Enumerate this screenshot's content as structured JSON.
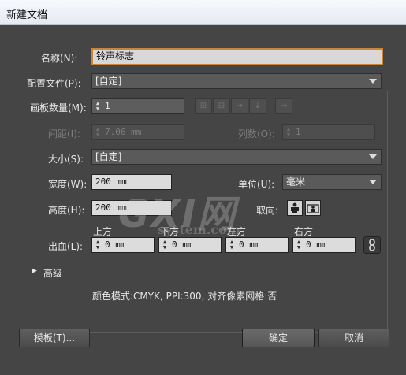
{
  "window": {
    "title": "新建文档"
  },
  "name": {
    "label": "名称(N):",
    "value": "铃声标志"
  },
  "profile": {
    "label": "配置文件(P):",
    "value": "[自定]"
  },
  "artboards": {
    "count_label": "画板数量(M):",
    "count_value": "1",
    "spacing_label": "间距(I):",
    "spacing_value": "7.06 mm",
    "columns_label": "列数(O):",
    "columns_value": "1"
  },
  "size": {
    "label": "大小(S):",
    "value": "[自定]"
  },
  "width": {
    "label": "宽度(W):",
    "value": "200 mm"
  },
  "units": {
    "label": "单位(U):",
    "value": "毫米"
  },
  "height": {
    "label": "高度(H):",
    "value": "200 mm"
  },
  "orientation": {
    "label": "取向:"
  },
  "bleed": {
    "label": "出血(L):",
    "top_label": "上方",
    "top_value": "0 mm",
    "bottom_label": "下方",
    "bottom_value": "0 mm",
    "left_label": "左方",
    "left_value": "0 mm",
    "right_label": "右方",
    "right_value": "0 mm"
  },
  "advanced": {
    "label": "高级"
  },
  "info": {
    "text": "颜色模式:CMYK, PPI:300, 对齐像素网格:否"
  },
  "buttons": {
    "templates": "模板(T)...",
    "ok": "确定",
    "cancel": "取消"
  },
  "watermark": {
    "brand": "GXI网",
    "site": "system.com"
  },
  "icons": {
    "spin": "spinner-arrows",
    "artboard_layout": [
      "grid-by-row-icon",
      "grid-by-column-icon",
      "arrange-by-row-icon",
      "arrange-by-column-icon",
      "right-to-left-icon"
    ],
    "orientation": [
      "portrait-icon",
      "landscape-icon"
    ],
    "bleed_link": "chain-link-icon"
  },
  "colors": {
    "focus_border": "#c7863a",
    "dialog_bg": "#454545"
  }
}
